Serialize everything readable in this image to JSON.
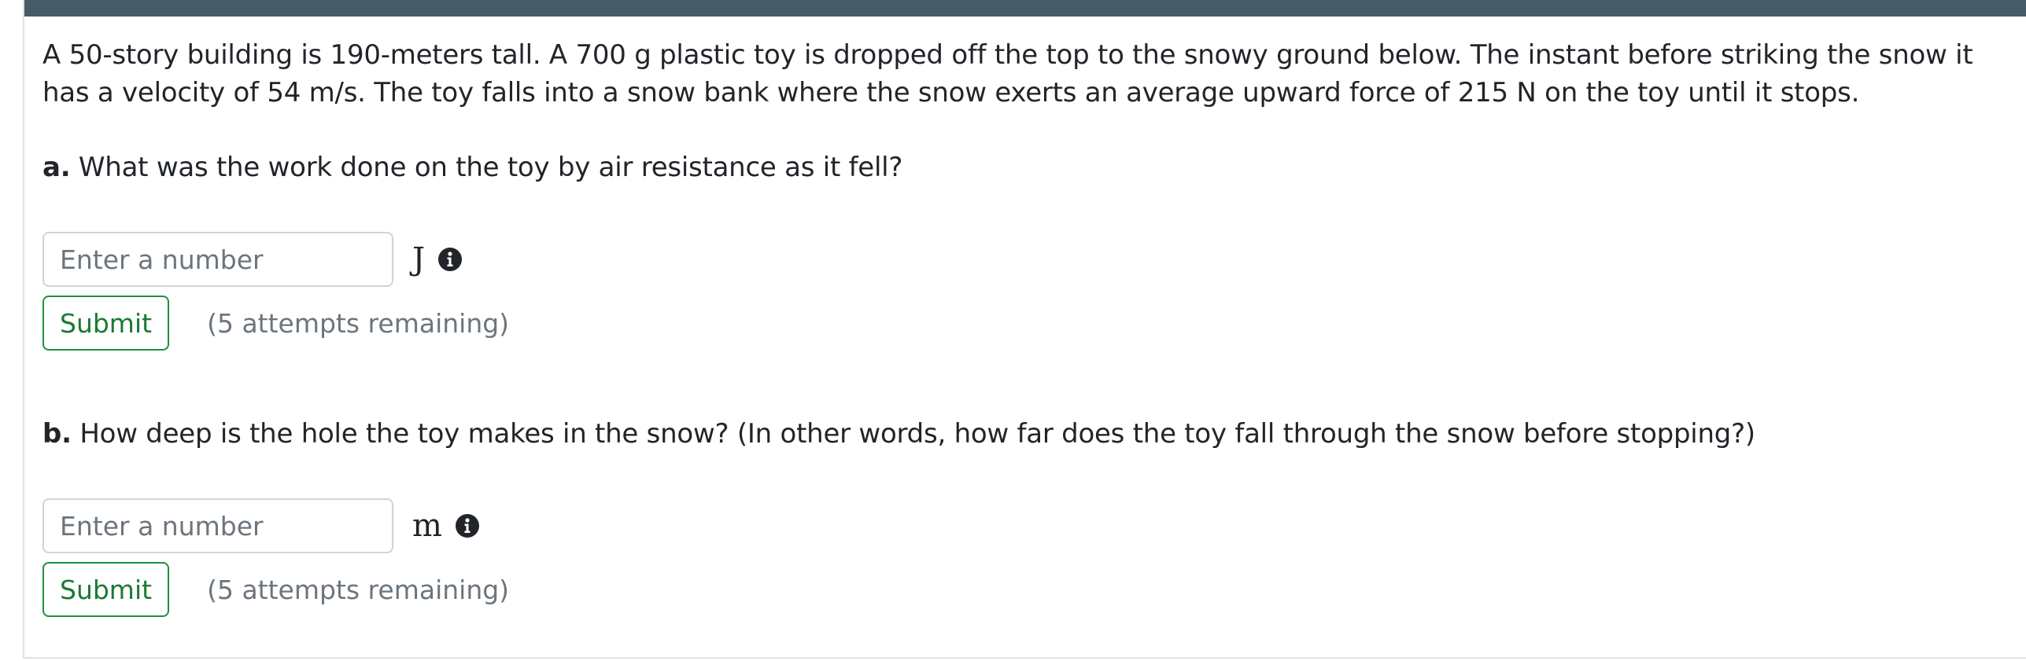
{
  "problem": {
    "intro": "A 50-story building is 190-meters tall. A 700 g plastic toy is dropped off the top to the snowy ground below. The instant before striking the snow it has a velocity of 54 m/s. The toy falls into a snow bank where the snow exerts an average upward force of 215 N on the toy until it stops."
  },
  "parts": [
    {
      "letter": "a.",
      "question": "What was the work done on the toy by air resistance as it fell?",
      "placeholder": "Enter a number",
      "unit": "J",
      "submit_label": "Submit",
      "attempts": "(5 attempts remaining)"
    },
    {
      "letter": "b.",
      "question": "How deep is the hole the toy makes in the snow? (In other words, how far does the toy fall through the snow before stopping?)",
      "placeholder": "Enter a number",
      "unit": "m",
      "submit_label": "Submit",
      "attempts": "(5 attempts remaining)"
    }
  ],
  "icons": {
    "info": "info-circle-icon"
  },
  "colors": {
    "header_bar": "#475b66",
    "submit_border": "#1e8f3e",
    "muted_text": "#6c757d"
  }
}
